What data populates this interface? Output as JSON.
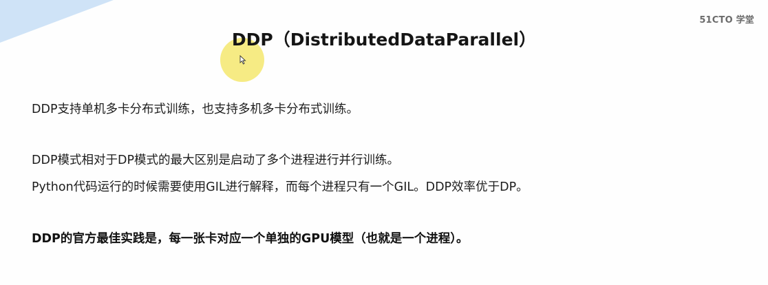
{
  "watermark": "51CTO 学堂",
  "slide": {
    "title": "DDP（DistributedDataParallel）",
    "paragraphs": [
      "DDP支持单机多卡分布式训练，也支持多机多卡分布式训练。",
      "DDP模式相对于DP模式的最大区别是启动了多个进程进行并行训练。",
      "Python代码运行的时候需要使用GIL进行解释，而每个进程只有一个GIL。DDP效率优于DP。",
      "DDP的官方最佳实践是，每一张卡对应一个单独的GPU模型（也就是一个进程）。"
    ]
  },
  "colors": {
    "accent_corner": "#cfe3f7",
    "pointer_highlight": "#f5e86e",
    "text": "#1d1d1d"
  },
  "icons": {
    "cursor": "mouse-pointer-icon"
  }
}
